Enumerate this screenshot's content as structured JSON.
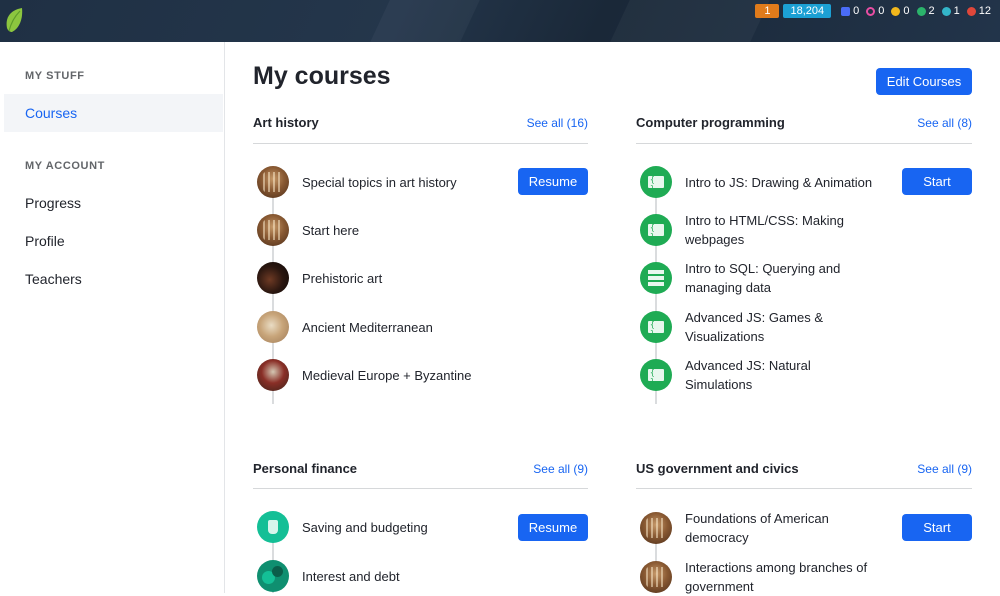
{
  "topbar": {
    "streak": "1",
    "points": "18,204",
    "badges": [
      {
        "name": "blue-badge-icon",
        "count": "0",
        "color": "#4a6cf7"
      },
      {
        "name": "pink-badge-icon",
        "count": "0",
        "color": "#e84ea3"
      },
      {
        "name": "gold-badge-icon",
        "count": "0",
        "color": "#f2b71c"
      },
      {
        "name": "green-badge-icon",
        "count": "2",
        "color": "#2bb36b"
      },
      {
        "name": "teal-badge-icon",
        "count": "1",
        "color": "#33b5c9"
      },
      {
        "name": "red-badge-icon",
        "count": "12",
        "color": "#e0473a"
      }
    ]
  },
  "sidebar": {
    "my_stuff_heading": "MY STUFF",
    "courses_label": "Courses",
    "my_account_heading": "MY ACCOUNT",
    "items": [
      "Progress",
      "Profile",
      "Teachers"
    ]
  },
  "main": {
    "title": "My courses",
    "edit_button": "Edit Courses"
  },
  "sections": [
    {
      "title": "Art history",
      "see_all": "See all (16)",
      "action": "Resume",
      "courses": [
        "Special topics in art history",
        "Start here",
        "Prehistoric art",
        "Ancient Mediterranean",
        "Medieval Europe + Byzantine"
      ]
    },
    {
      "title": "Computer programming",
      "see_all": "See all (8)",
      "action": "Start",
      "courses": [
        "Intro to JS: Drawing & Animation",
        "Intro to HTML/CSS: Making webpages",
        "Intro to SQL: Querying and managing data",
        "Advanced JS: Games & Visualizations",
        "Advanced JS: Natural Simulations"
      ]
    },
    {
      "title": "Personal finance",
      "see_all": "See all (9)",
      "action": "Resume",
      "courses": [
        "Saving and budgeting",
        "Interest and debt"
      ]
    },
    {
      "title": "US government and civics",
      "see_all": "See all (9)",
      "action": "Start",
      "courses": [
        "Foundations of American democracy",
        "Interactions among branches of government"
      ]
    }
  ],
  "colors": {
    "accent": "#1865f2",
    "topbar": "#1c2b3d",
    "computing": "#1fab54",
    "finance": "#14bf96"
  }
}
